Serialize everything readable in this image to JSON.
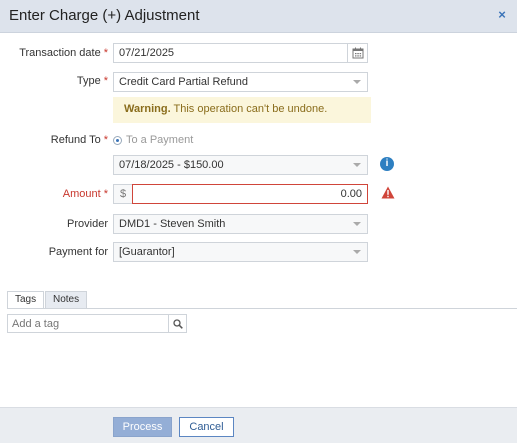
{
  "dialog": {
    "title": "Enter Charge (+) Adjustment",
    "close_symbol": "×"
  },
  "form": {
    "transaction_date": {
      "label": "Transaction date",
      "required": "*",
      "value": "07/21/2025"
    },
    "type": {
      "label": "Type",
      "required": "*",
      "value": "Credit Card Partial Refund"
    },
    "warning": {
      "bold": "Warning.",
      "text": " This operation can't be undone."
    },
    "refund_to": {
      "label": "Refund To",
      "required": "*",
      "option": "To a Payment",
      "payment_value": "07/18/2025 - $150.00"
    },
    "amount": {
      "label": "Amount",
      "required": "*",
      "prefix": "$",
      "value": "0.00"
    },
    "provider": {
      "label": "Provider",
      "value": "DMD1 - Steven Smith"
    },
    "payment_for": {
      "label": "Payment for",
      "value": "[Guarantor]"
    }
  },
  "tabs": [
    {
      "label": "Tags",
      "active": true
    },
    {
      "label": "Notes",
      "active": false
    }
  ],
  "tag_search": {
    "placeholder": "Add a tag"
  },
  "footer": {
    "process_label": "Process",
    "cancel_label": "Cancel"
  },
  "icons": {
    "calendar": "calendar-icon",
    "info": "info-icon",
    "warning": "warning-triangle-icon",
    "search": "search-icon",
    "close": "close-icon"
  },
  "colors": {
    "accent": "#3a73b8",
    "required": "#c8372d",
    "warning_bg": "#fbf6dc",
    "warning_text": "#8a6d1c",
    "info": "#2d7fc1",
    "error": "#d0453a"
  }
}
